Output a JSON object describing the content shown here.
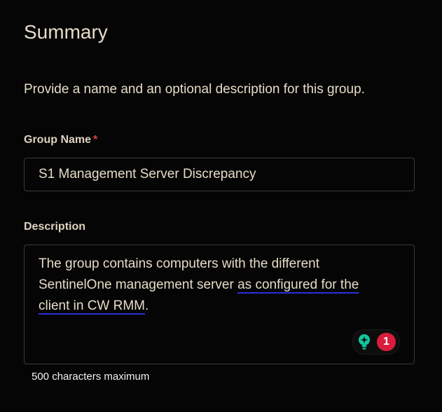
{
  "summary": {
    "title": "Summary",
    "subtitle": "Provide a name and an optional description for this group."
  },
  "group_name": {
    "label": "Group Name",
    "required_marker": "*",
    "value": "S1 Management Server Discrepancy"
  },
  "description": {
    "label": "Description",
    "text_part1": "The group contains computers with the different SentinelOne management server ",
    "text_underlined": "as configured for the client in CW RMM",
    "text_part2": ".",
    "helper": "500 characters maximum"
  },
  "grammar_widget": {
    "icon": "lightbulb-icon",
    "issue_count": "1",
    "icon_color": "#14c6a0",
    "badge_color": "#d81d3d"
  },
  "colors": {
    "background": "#050505",
    "text": "#e6dcc7",
    "required": "#e0443e",
    "underline": "#2b2fd6"
  }
}
